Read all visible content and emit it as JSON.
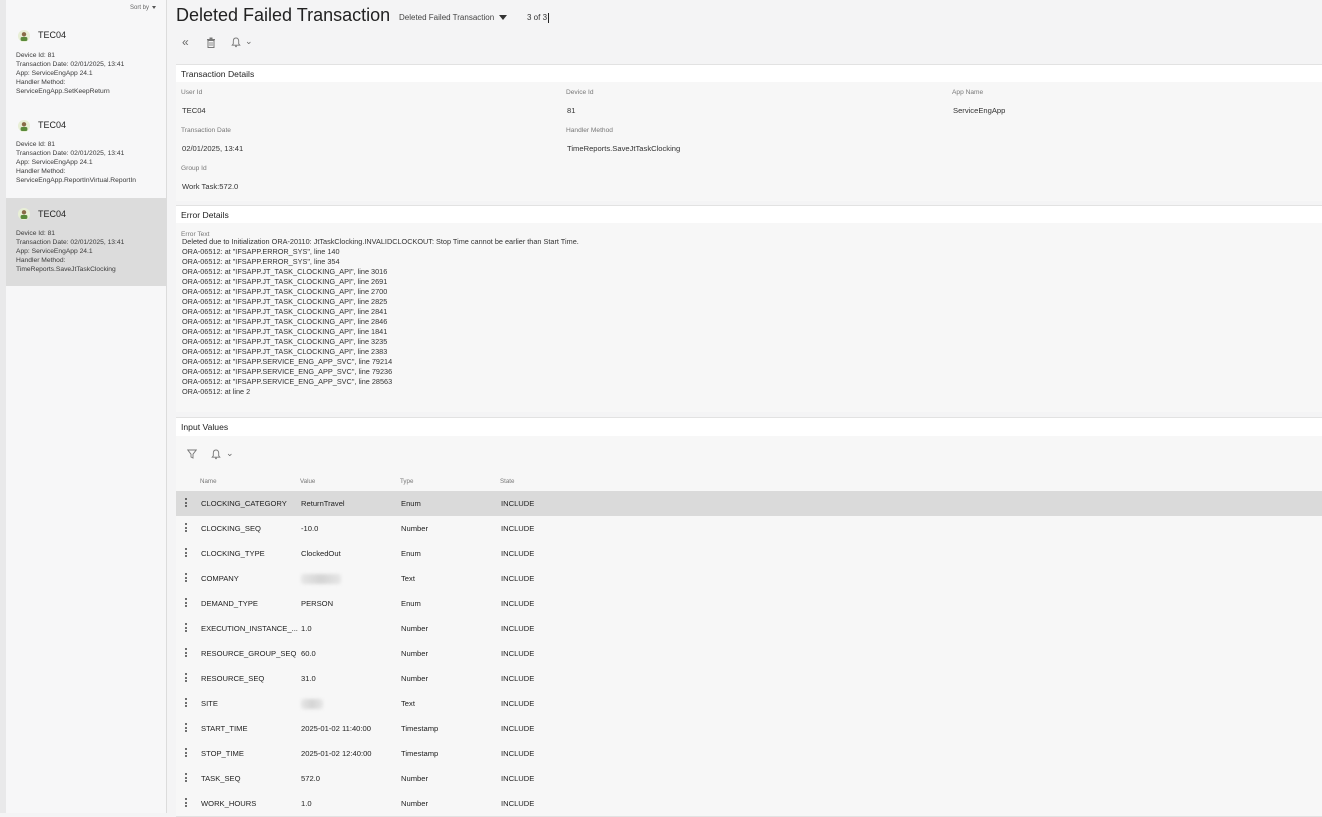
{
  "sidebar": {
    "sort_by": "Sort by",
    "cards": [
      {
        "title": "TEC04",
        "lines": [
          "Device Id:  81",
          "Transaction Date:  02/01/2025, 13:41",
          "App:  ServiceEngApp 24.1",
          "Handler Method:",
          "ServiceEngApp.SetKeepReturn"
        ]
      },
      {
        "title": "TEC04",
        "lines": [
          "Device Id:  81",
          "Transaction Date:  02/01/2025, 13:41",
          "App:  ServiceEngApp 24.1",
          "Handler Method:",
          "ServiceEngApp.ReportInVirtual.ReportIn"
        ]
      },
      {
        "title": "TEC04",
        "lines": [
          "Device Id:  81",
          "Transaction Date:  02/01/2025, 13:41",
          "App:  ServiceEngApp 24.1",
          "Handler Method:",
          "TimeReports.SaveJtTaskClocking"
        ]
      }
    ]
  },
  "header": {
    "title": "Deleted Failed Transaction",
    "selector": "Deleted Failed Transaction",
    "pager": "3 of 3"
  },
  "toolbar": {
    "icons": [
      "double-chevron-left-icon",
      "trash-icon",
      "bell-icon",
      "chevron-down-icon"
    ],
    "back_glyph": "«",
    "delete_glyph": "🗑",
    "bell_glyph": "♫",
    "dropdown_glyph": "⌄"
  },
  "transaction_details": {
    "title": "Transaction Details",
    "user_id_label": "User Id",
    "user_id": "TEC04",
    "device_id_label": "Device Id",
    "device_id": "81",
    "app_name_label": "App Name",
    "app_name": "ServiceEngApp",
    "transaction_date_label": "Transaction Date",
    "transaction_date": "02/01/2025, 13:41",
    "handler_method_label": "Handler Method",
    "handler_method": "TimeReports.SaveJtTaskClocking",
    "group_id_label": "Group Id",
    "group_id": "Work Task:572.0"
  },
  "error_details": {
    "title": "Error Details",
    "error_text_label": "Error Text",
    "error_text": "Deleted due to Initialization ORA-20110: JtTaskClocking.INVALIDCLOCKOUT: Stop Time cannot be earlier than Start Time.\nORA-06512: at \"IFSAPP.ERROR_SYS\", line 140\nORA-06512: at \"IFSAPP.ERROR_SYS\", line 354\nORA-06512: at \"IFSAPP.JT_TASK_CLOCKING_API\", line 3016\nORA-06512: at \"IFSAPP.JT_TASK_CLOCKING_API\", line 2691\nORA-06512: at \"IFSAPP.JT_TASK_CLOCKING_API\", line 2700\nORA-06512: at \"IFSAPP.JT_TASK_CLOCKING_API\", line 2825\nORA-06512: at \"IFSAPP.JT_TASK_CLOCKING_API\", line 2841\nORA-06512: at \"IFSAPP.JT_TASK_CLOCKING_API\", line 2846\nORA-06512: at \"IFSAPP.JT_TASK_CLOCKING_API\", line 1841\nORA-06512: at \"IFSAPP.JT_TASK_CLOCKING_API\", line 3235\nORA-06512: at \"IFSAPP.JT_TASK_CLOCKING_API\", line 2383\nORA-06512: at \"IFSAPP.SERVICE_ENG_APP_SVC\", line 79214\nORA-06512: at \"IFSAPP.SERVICE_ENG_APP_SVC\", line 79236\nORA-06512: at \"IFSAPP.SERVICE_ENG_APP_SVC\", line 28563\nORA-06512: at line 2"
  },
  "input_values": {
    "title": "Input Values",
    "filter_glyph": "∇",
    "bell_glyph": "♫",
    "dropdown_glyph": "⌄",
    "columns": [
      "Name",
      "Value",
      "Type",
      "State"
    ],
    "rows": [
      {
        "name": "CLOCKING_CATEGORY",
        "value": "ReturnTravel",
        "type": "Enum",
        "state": "INCLUDE"
      },
      {
        "name": "CLOCKING_SEQ",
        "value": "-10.0",
        "type": "Number",
        "state": "INCLUDE"
      },
      {
        "name": "CLOCKING_TYPE",
        "value": "ClockedOut",
        "type": "Enum",
        "state": "INCLUDE"
      },
      {
        "name": "COMPANY",
        "value": "",
        "type": "Text",
        "state": "INCLUDE",
        "redacted": true
      },
      {
        "name": "DEMAND_TYPE",
        "value": "PERSON",
        "type": "Enum",
        "state": "INCLUDE"
      },
      {
        "name": "EXECUTION_INSTANCE_...",
        "value": "1.0",
        "type": "Number",
        "state": "INCLUDE"
      },
      {
        "name": "RESOURCE_GROUP_SEQ",
        "value": "60.0",
        "type": "Number",
        "state": "INCLUDE"
      },
      {
        "name": "RESOURCE_SEQ",
        "value": "31.0",
        "type": "Number",
        "state": "INCLUDE"
      },
      {
        "name": "SITE",
        "value": "",
        "type": "Text",
        "state": "INCLUDE",
        "redacted": true
      },
      {
        "name": "START_TIME",
        "value": "2025-01-02 11:40:00",
        "type": "Timestamp",
        "state": "INCLUDE"
      },
      {
        "name": "STOP_TIME",
        "value": "2025-01-02 12:40:00",
        "type": "Timestamp",
        "state": "INCLUDE"
      },
      {
        "name": "TASK_SEQ",
        "value": "572.0",
        "type": "Number",
        "state": "INCLUDE"
      },
      {
        "name": "WORK_HOURS",
        "value": "1.0",
        "type": "Number",
        "state": "INCLUDE"
      }
    ]
  }
}
